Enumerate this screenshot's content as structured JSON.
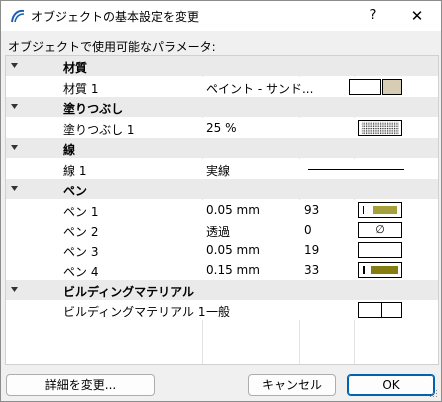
{
  "window": {
    "title": "オブジェクトの基本設定を変更",
    "help_label": "?",
    "close_label": "✕"
  },
  "subtitle": "オブジェクトで使用可能なパラメータ:",
  "categories": {
    "material": {
      "label": "材質",
      "items": [
        {
          "name": "材質 1",
          "value": "ペイント - サンド...",
          "swatch_color": "#d6cdb4"
        }
      ]
    },
    "fill": {
      "label": "塗りつぶし",
      "items": [
        {
          "name": "塗りつぶし 1",
          "value": "25 %"
        }
      ]
    },
    "line": {
      "label": "線",
      "items": [
        {
          "name": "線 1",
          "value": "実線"
        }
      ]
    },
    "pen": {
      "label": "ペン",
      "items": [
        {
          "name": "ペン 1",
          "value": "0.05 mm",
          "number": "93",
          "swatch_color": "#a5a03a"
        },
        {
          "name": "ペン 2",
          "value": "透過",
          "number": "0",
          "swatch_symbol": "∅"
        },
        {
          "name": "ペン 3",
          "value": "0.05 mm",
          "number": "19",
          "swatch_color": "#ffffff"
        },
        {
          "name": "ペン 4",
          "value": "0.15 mm",
          "number": "33",
          "swatch_color": "#857d12"
        }
      ]
    },
    "building_material": {
      "label": "ビルディングマテリアル",
      "items": [
        {
          "name": "ビルディングマテリアル 1",
          "value": "一般"
        }
      ]
    }
  },
  "buttons": {
    "details": "詳細を変更...",
    "cancel": "キャンセル",
    "ok": "OK"
  }
}
